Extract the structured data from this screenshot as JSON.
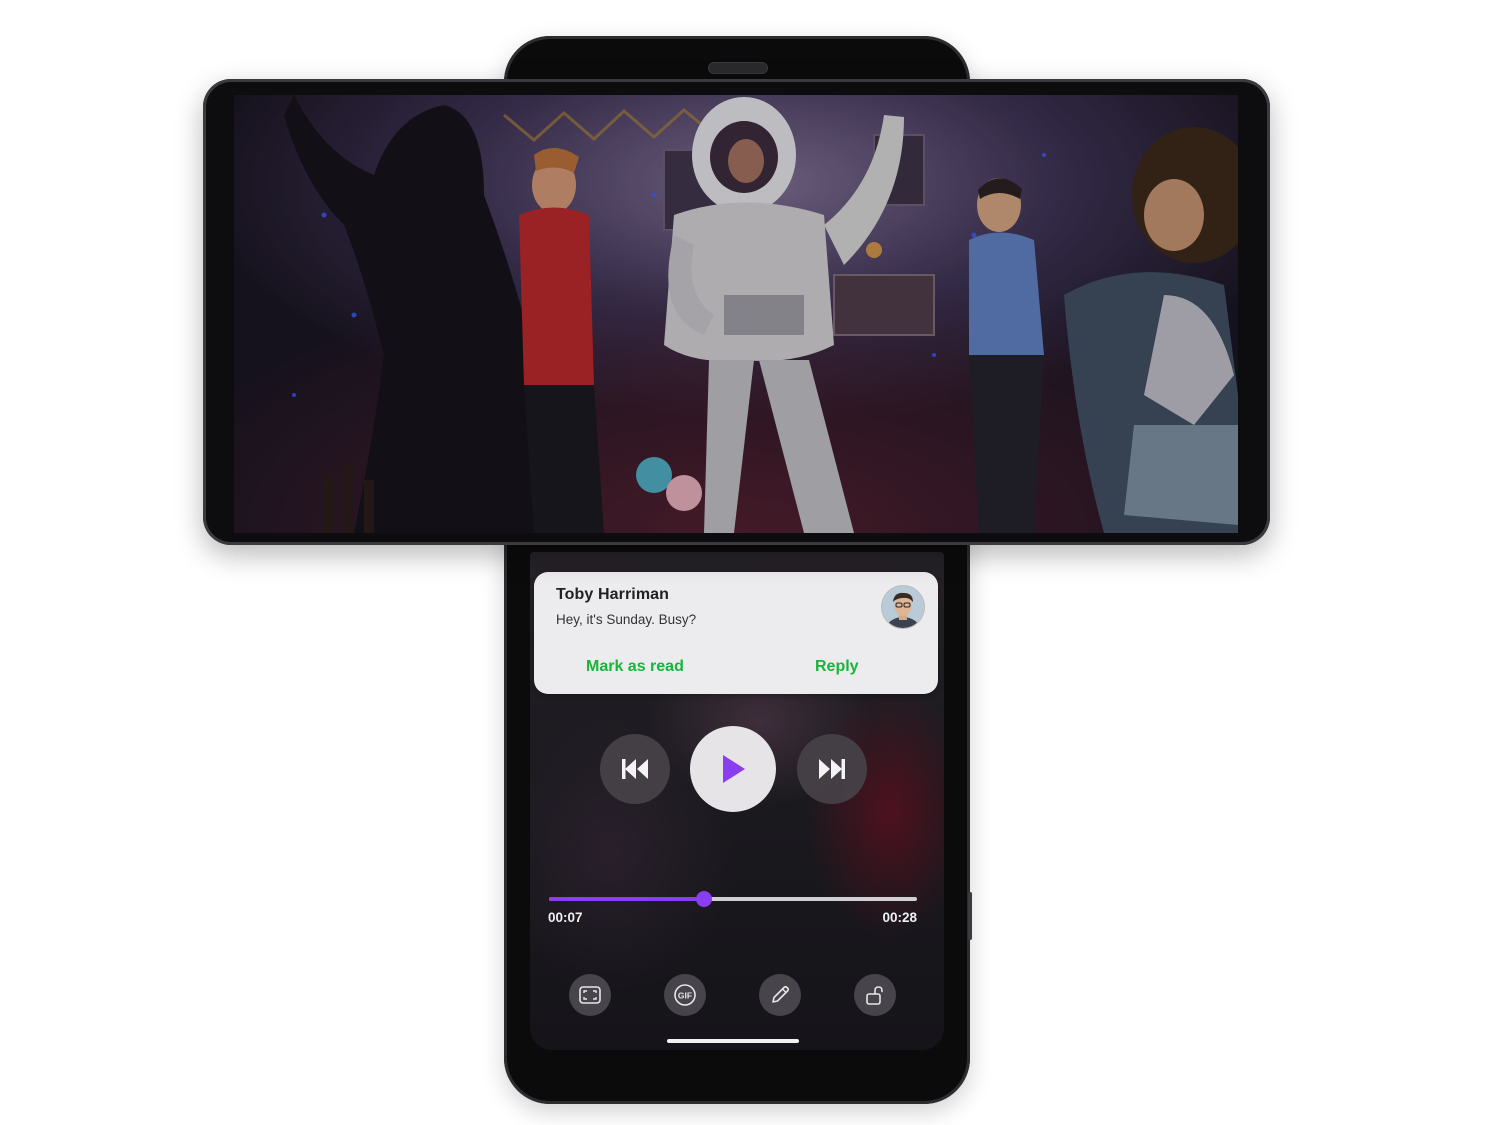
{
  "notification": {
    "sender": "Toby Harriman",
    "message": "Hey, it's Sunday. Busy?",
    "actions": {
      "mark_read": "Mark as read",
      "reply": "Reply"
    },
    "action_color": "#19b43a"
  },
  "player": {
    "controls": [
      "previous-icon",
      "play-icon",
      "next-icon"
    ],
    "elapsed": "00:07",
    "duration": "00:28",
    "progress_fraction": 0.42,
    "accent_color": "#8b3df0"
  },
  "tools": [
    "screenshot-frame-icon",
    "gif-icon",
    "pencil-icon",
    "rotation-lock-icon"
  ],
  "tools_gif_label": "GIF"
}
